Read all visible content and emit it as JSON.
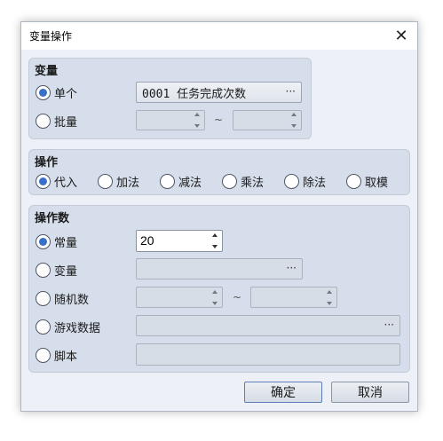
{
  "dialog": {
    "title": "变量操作",
    "close_glyph": "✕"
  },
  "variable_group": {
    "title": "变量",
    "single_label": "单个",
    "single_checked": true,
    "single_value": "0001 任务完成次数",
    "single_button": "···",
    "batch_label": "批量",
    "batch_checked": false,
    "range_sep": "~"
  },
  "operation_group": {
    "title": "操作",
    "options": [
      {
        "label": "代入",
        "checked": true
      },
      {
        "label": "加法",
        "checked": false
      },
      {
        "label": "减法",
        "checked": false
      },
      {
        "label": "乘法",
        "checked": false
      },
      {
        "label": "除法",
        "checked": false
      },
      {
        "label": "取模",
        "checked": false
      }
    ]
  },
  "operand_group": {
    "title": "操作数",
    "constant_label": "常量",
    "constant_checked": true,
    "constant_value": "20",
    "variable_label": "变量",
    "variable_button": "···",
    "random_label": "随机数",
    "range_sep": "~",
    "game_data_label": "游戏数据",
    "game_data_button": "···",
    "script_label": "脚本"
  },
  "footer": {
    "ok_label": "确定",
    "cancel_label": "取消"
  },
  "colors": {
    "accent": "#3a6fc9",
    "group_bg": "#d5deea",
    "window_bg": "#edf1f7"
  }
}
